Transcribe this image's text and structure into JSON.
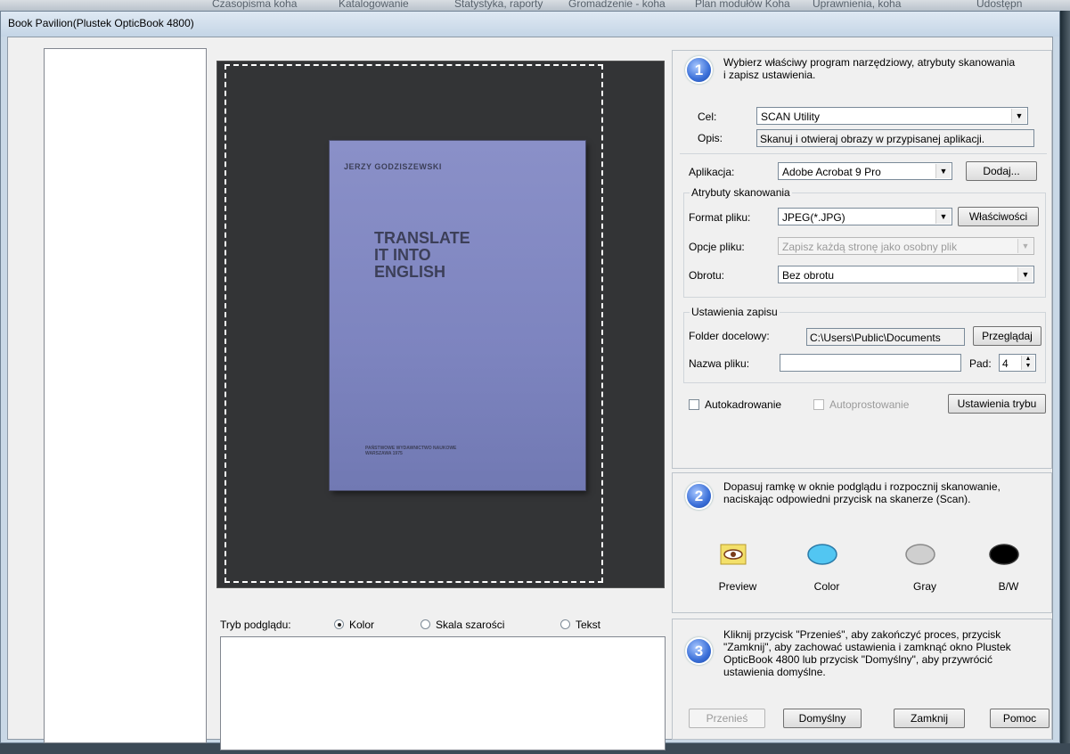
{
  "background": {
    "menu_items": [
      "Czasopisma koha",
      "Katalogowanie",
      "Statystyka, raporty",
      "Gromadzenie - koha",
      "Plan modułów Koha",
      "Uprawnienia, koha",
      "Udostępn"
    ]
  },
  "window": {
    "title": "Book Pavilion(Plustek OpticBook 4800)"
  },
  "preview": {
    "book_author": "JERZY GODZISZEWSKI",
    "book_title": "TRANSLATE\nIT INTO\nENGLISH",
    "book_publisher": "PAŃSTWOWE WYDAWNICTWO NAUKOWE\nWARSZAWA 1975",
    "mode_label": "Tryb podglądu:",
    "modes": [
      {
        "label": "Kolor",
        "selected": true
      },
      {
        "label": "Skala szarości",
        "selected": false
      },
      {
        "label": "Tekst",
        "selected": false
      }
    ]
  },
  "step1": {
    "number": "1",
    "instructions": "Wybierz właściwy program narzędziowy, atrybuty skanowania i zapisz ustawienia.",
    "target_label": "Cel:",
    "target_value": "SCAN Utility",
    "desc_label": "Opis:",
    "desc_value": "Skanuj i otwieraj obrazy w przypisanej aplikacji.",
    "app_label": "Aplikacja:",
    "app_value": "Adobe Acrobat 9 Pro",
    "add_button": "Dodaj...",
    "scan_attrs_legend": "Atrybuty skanowania",
    "file_format_label": "Format pliku:",
    "file_format_value": "JPEG(*.JPG)",
    "properties_button": "Właściwości",
    "file_options_label": "Opcje pliku:",
    "file_options_value": "Zapisz każdą stronę jako osobny plik",
    "rotation_label": "Obrotu:",
    "rotation_value": "Bez obrotu",
    "save_settings_legend": "Ustawienia zapisu",
    "folder_label": "Folder docelowy:",
    "folder_value": "C:\\Users\\Public\\Documents",
    "browse_button": "Przeglądaj",
    "filename_label": "Nazwa pliku:",
    "filename_value": "",
    "pad_label": "Pad:",
    "pad_value": "4",
    "autocrop_label": "Autokadrowanie",
    "autocrop_checked": false,
    "deskew_label": "Autoprostowanie",
    "deskew_checked": false,
    "mode_settings_button": "Ustawienia trybu"
  },
  "step2": {
    "number": "2",
    "instructions": "Dopasuj ramkę w oknie podglądu i rozpocznij skanowanie, naciskając odpowiedni przycisk na skanerze (Scan).",
    "buttons": [
      {
        "label": "Preview",
        "icon": "eye-icon",
        "color": "#f3e06a"
      },
      {
        "label": "Color",
        "icon": "color-scan-icon",
        "color": "#52c6f2"
      },
      {
        "label": "Gray",
        "icon": "gray-scan-icon",
        "color": "#c8c8c8"
      },
      {
        "label": "B/W",
        "icon": "bw-scan-icon",
        "color": "#000000"
      }
    ]
  },
  "step3": {
    "number": "3",
    "instructions": "Kliknij przycisk \"Przenieś\", aby zakończyć proces, przycisk \"Zamknij\", aby zachować ustawienia i zamknąć okno Plustek OpticBook 4800 lub przycisk \"Domyślny\", aby przywrócić ustawienia domyślne.",
    "transfer_button": "Przenieś",
    "default_button": "Domyślny",
    "close_button": "Zamknij",
    "help_button": "Pomoc"
  }
}
